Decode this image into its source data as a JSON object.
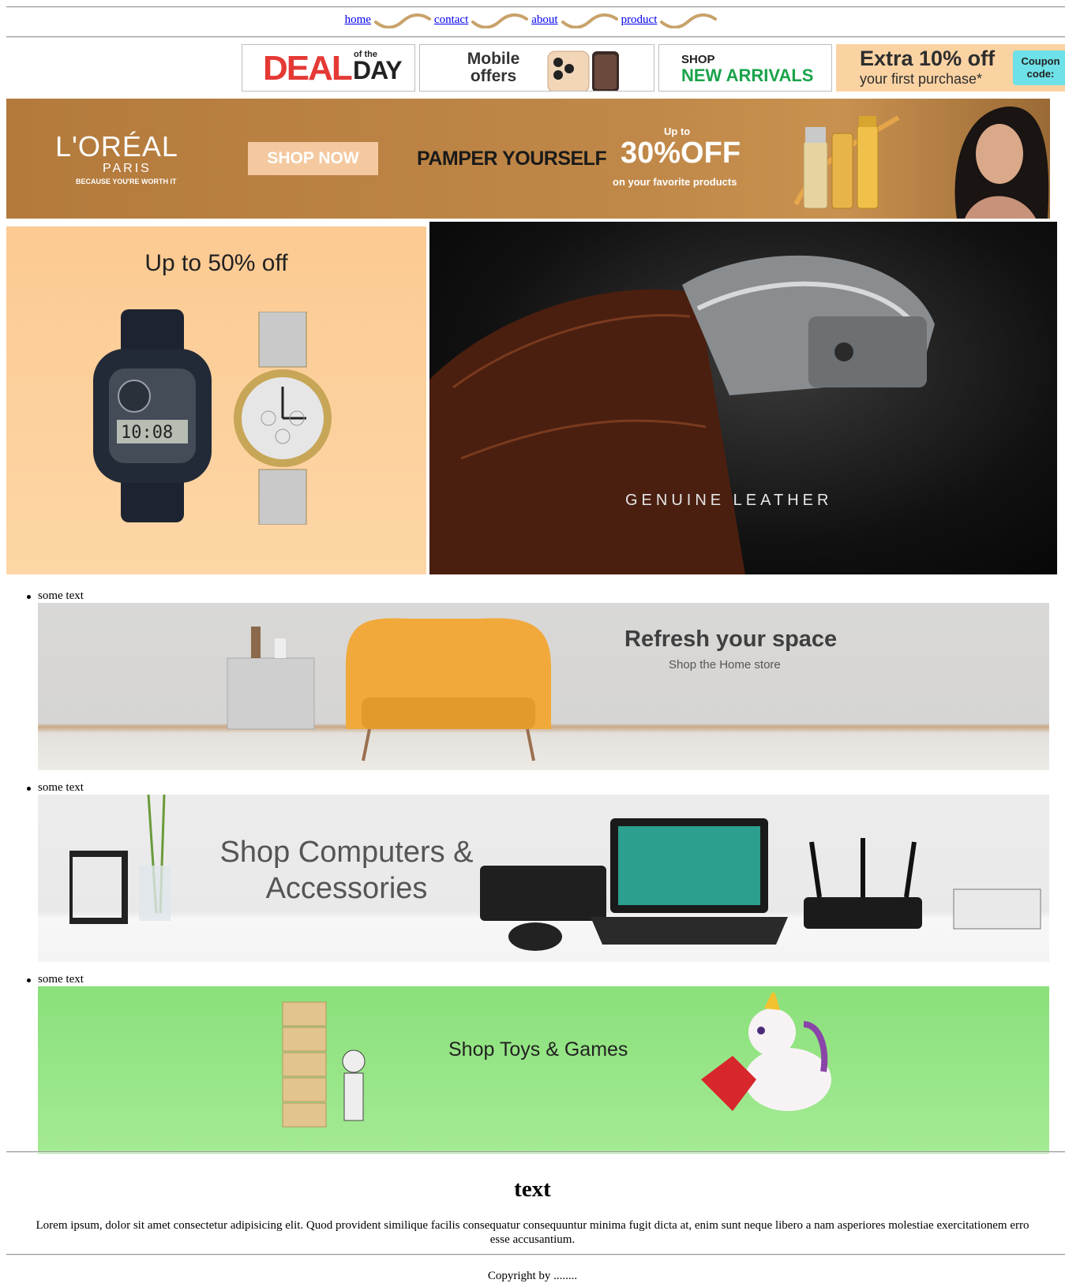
{
  "nav": {
    "items": [
      {
        "label": "home"
      },
      {
        "label": "contact"
      },
      {
        "label": "about"
      },
      {
        "label": "product"
      }
    ]
  },
  "promos": {
    "deal": {
      "big": "DEAL",
      "of_the": "of the",
      "day": "DAY"
    },
    "mobile": {
      "line1": "Mobile",
      "line2": "offers"
    },
    "arrivals": {
      "line1": "SHOP",
      "line2": "NEW ARRIVALS"
    },
    "extra": {
      "line1": "Extra 10% off",
      "line2": "your first purchase*",
      "coupon1": "Coupon",
      "coupon2": "code:"
    }
  },
  "loreal_banner": {
    "brand": "L'ORÉAL",
    "city": "PARIS",
    "tagline": "BECAUSE YOU'RE WORTH IT",
    "cta": "SHOP NOW",
    "headline": "PAMPER YOURSELF",
    "up_to": "Up to",
    "discount": "30%OFF",
    "subline": "on your favorite products"
  },
  "watches": {
    "left_heading": "Up to 50% off",
    "right_caption": "GENUINE LEATHER"
  },
  "list": {
    "items": [
      {
        "caption": "some text",
        "banner_title": "Refresh your space",
        "banner_sub": "Shop the Home store"
      },
      {
        "caption": "some text",
        "banner_title": "Shop Computers & Accessories"
      },
      {
        "caption": "some text",
        "banner_title": "Shop Toys & Games"
      }
    ]
  },
  "footer": {
    "title": "text",
    "paragraph_line1": "Lorem ipsum, dolor sit amet consectetur adipisicing elit. Quod provident similique facilis consequatur consequuntur minima fugit dicta at, enim sunt neque libero a nam asperiores molestiae exercitationem erro",
    "paragraph_line2": "esse accusantium.",
    "copyright": "Copyright by ........"
  },
  "colors": {
    "link": "#0000ee",
    "swirl": "#c8a26a",
    "deal_red": "#e53935",
    "arrivals_green": "#1aa34a",
    "loreal_bg": "#b37a3c",
    "watch_bg": "#fcca92",
    "toys_bg": "#8ae07a"
  }
}
